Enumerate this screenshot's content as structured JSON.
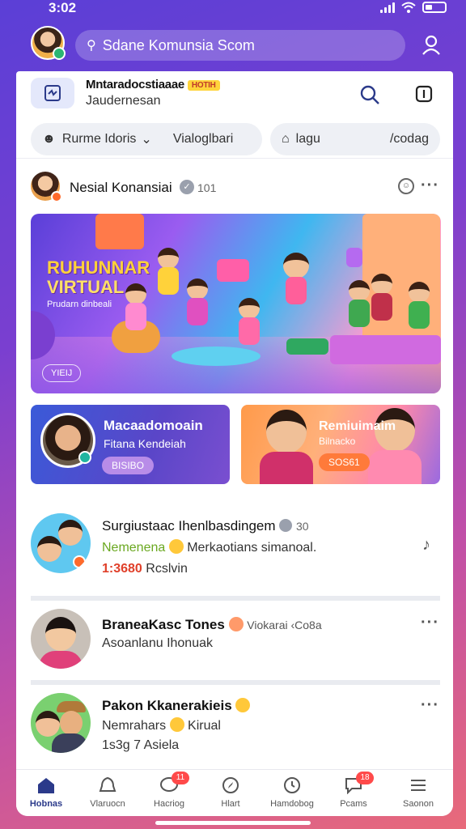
{
  "status": {
    "time": "3:02"
  },
  "topbar": {
    "search_text": "Sdane Komunsia Scom"
  },
  "header": {
    "title": "Mntaradocstiaaae",
    "badge": "HOTIH",
    "subtitle": "Jaudernesan"
  },
  "filters": {
    "chip1_label": "Rurme Idoris",
    "chip1_right": "Vialoglbari",
    "chip2_label": "lagu",
    "chip2_right": "/codag"
  },
  "post": {
    "author": "Nesial Konansiai",
    "count": "101",
    "hero": {
      "title_line1": "RUHUNNAR",
      "title_line2": "VIRTUAL",
      "subtitle": "Prudarn dinbeali",
      "tag": "YIEIJ"
    }
  },
  "cards": [
    {
      "title": "Macaadomoain",
      "subtitle": "Fitana Kendeiah",
      "pill": "BISIBO"
    },
    {
      "title": "Remiuimaim",
      "subtitle": "Bilnacko",
      "pill": "SOS61"
    }
  ],
  "list": [
    {
      "name": "Surgiustaac Ihenlbasdingem",
      "count": "30",
      "line2_highlight": "Nemenena",
      "line2_text": "Merkaotians simanoal.",
      "line3_red": "1:3680",
      "line3_text": "Rcslvin"
    },
    {
      "name": "BraneaKasc Tones",
      "line1_extra": "Viokarai ‹Co8a",
      "line2_text": "Asoanlanu Ihonuak"
    },
    {
      "name": "Pakon Kkanerakieis",
      "line2_text": "Nemrahars",
      "line2_extra": "Kirual",
      "line3_text": "1s3g 7 Asiela"
    }
  ],
  "nav": [
    {
      "label": "Hobnas",
      "icon": "home-icon",
      "active": true
    },
    {
      "label": "Vlaruocn",
      "icon": "bell-icon"
    },
    {
      "label": "Hacriog",
      "icon": "chat-icon",
      "badge": "11"
    },
    {
      "label": "Hlart",
      "icon": "compass-icon"
    },
    {
      "label": "Hamdobog",
      "icon": "clock-icon"
    },
    {
      "label": "Pcams",
      "icon": "message-icon",
      "badge": "18"
    },
    {
      "label": "Saonon",
      "icon": "menu-icon"
    }
  ],
  "colors": {
    "accent": "#2b3a8a",
    "badge": "#ff4a4a",
    "highlight": "#6aa820",
    "price_red": "#e0402a"
  }
}
